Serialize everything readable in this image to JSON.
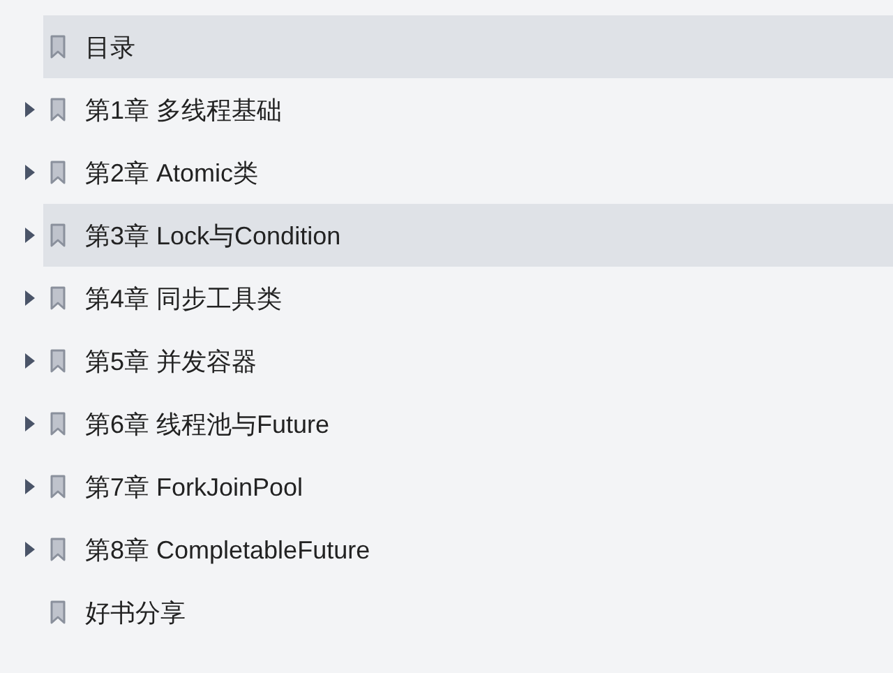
{
  "bookmarks": [
    {
      "label": "目录",
      "kind": "leaf",
      "selected": true
    },
    {
      "label": "第1章 多线程基础",
      "kind": "branch",
      "expanded": false,
      "selected": false
    },
    {
      "label": "第2章 Atomic类",
      "kind": "branch",
      "expanded": false,
      "selected": false
    },
    {
      "label": "第3章 Lock与Condition",
      "kind": "branch",
      "expanded": false,
      "selected": true
    },
    {
      "label": "第4章 同步工具类",
      "kind": "branch",
      "expanded": false,
      "selected": false
    },
    {
      "label": "第5章 并发容器",
      "kind": "branch",
      "expanded": false,
      "selected": false
    },
    {
      "label": "第6章 线程池与Future",
      "kind": "branch",
      "expanded": false,
      "selected": false
    },
    {
      "label": "第7章 ForkJoinPool",
      "kind": "branch",
      "expanded": false,
      "selected": false
    },
    {
      "label": "第8章 CompletableFuture",
      "kind": "branch",
      "expanded": false,
      "selected": false
    },
    {
      "label": "好书分享",
      "kind": "leaf",
      "selected": false
    }
  ]
}
